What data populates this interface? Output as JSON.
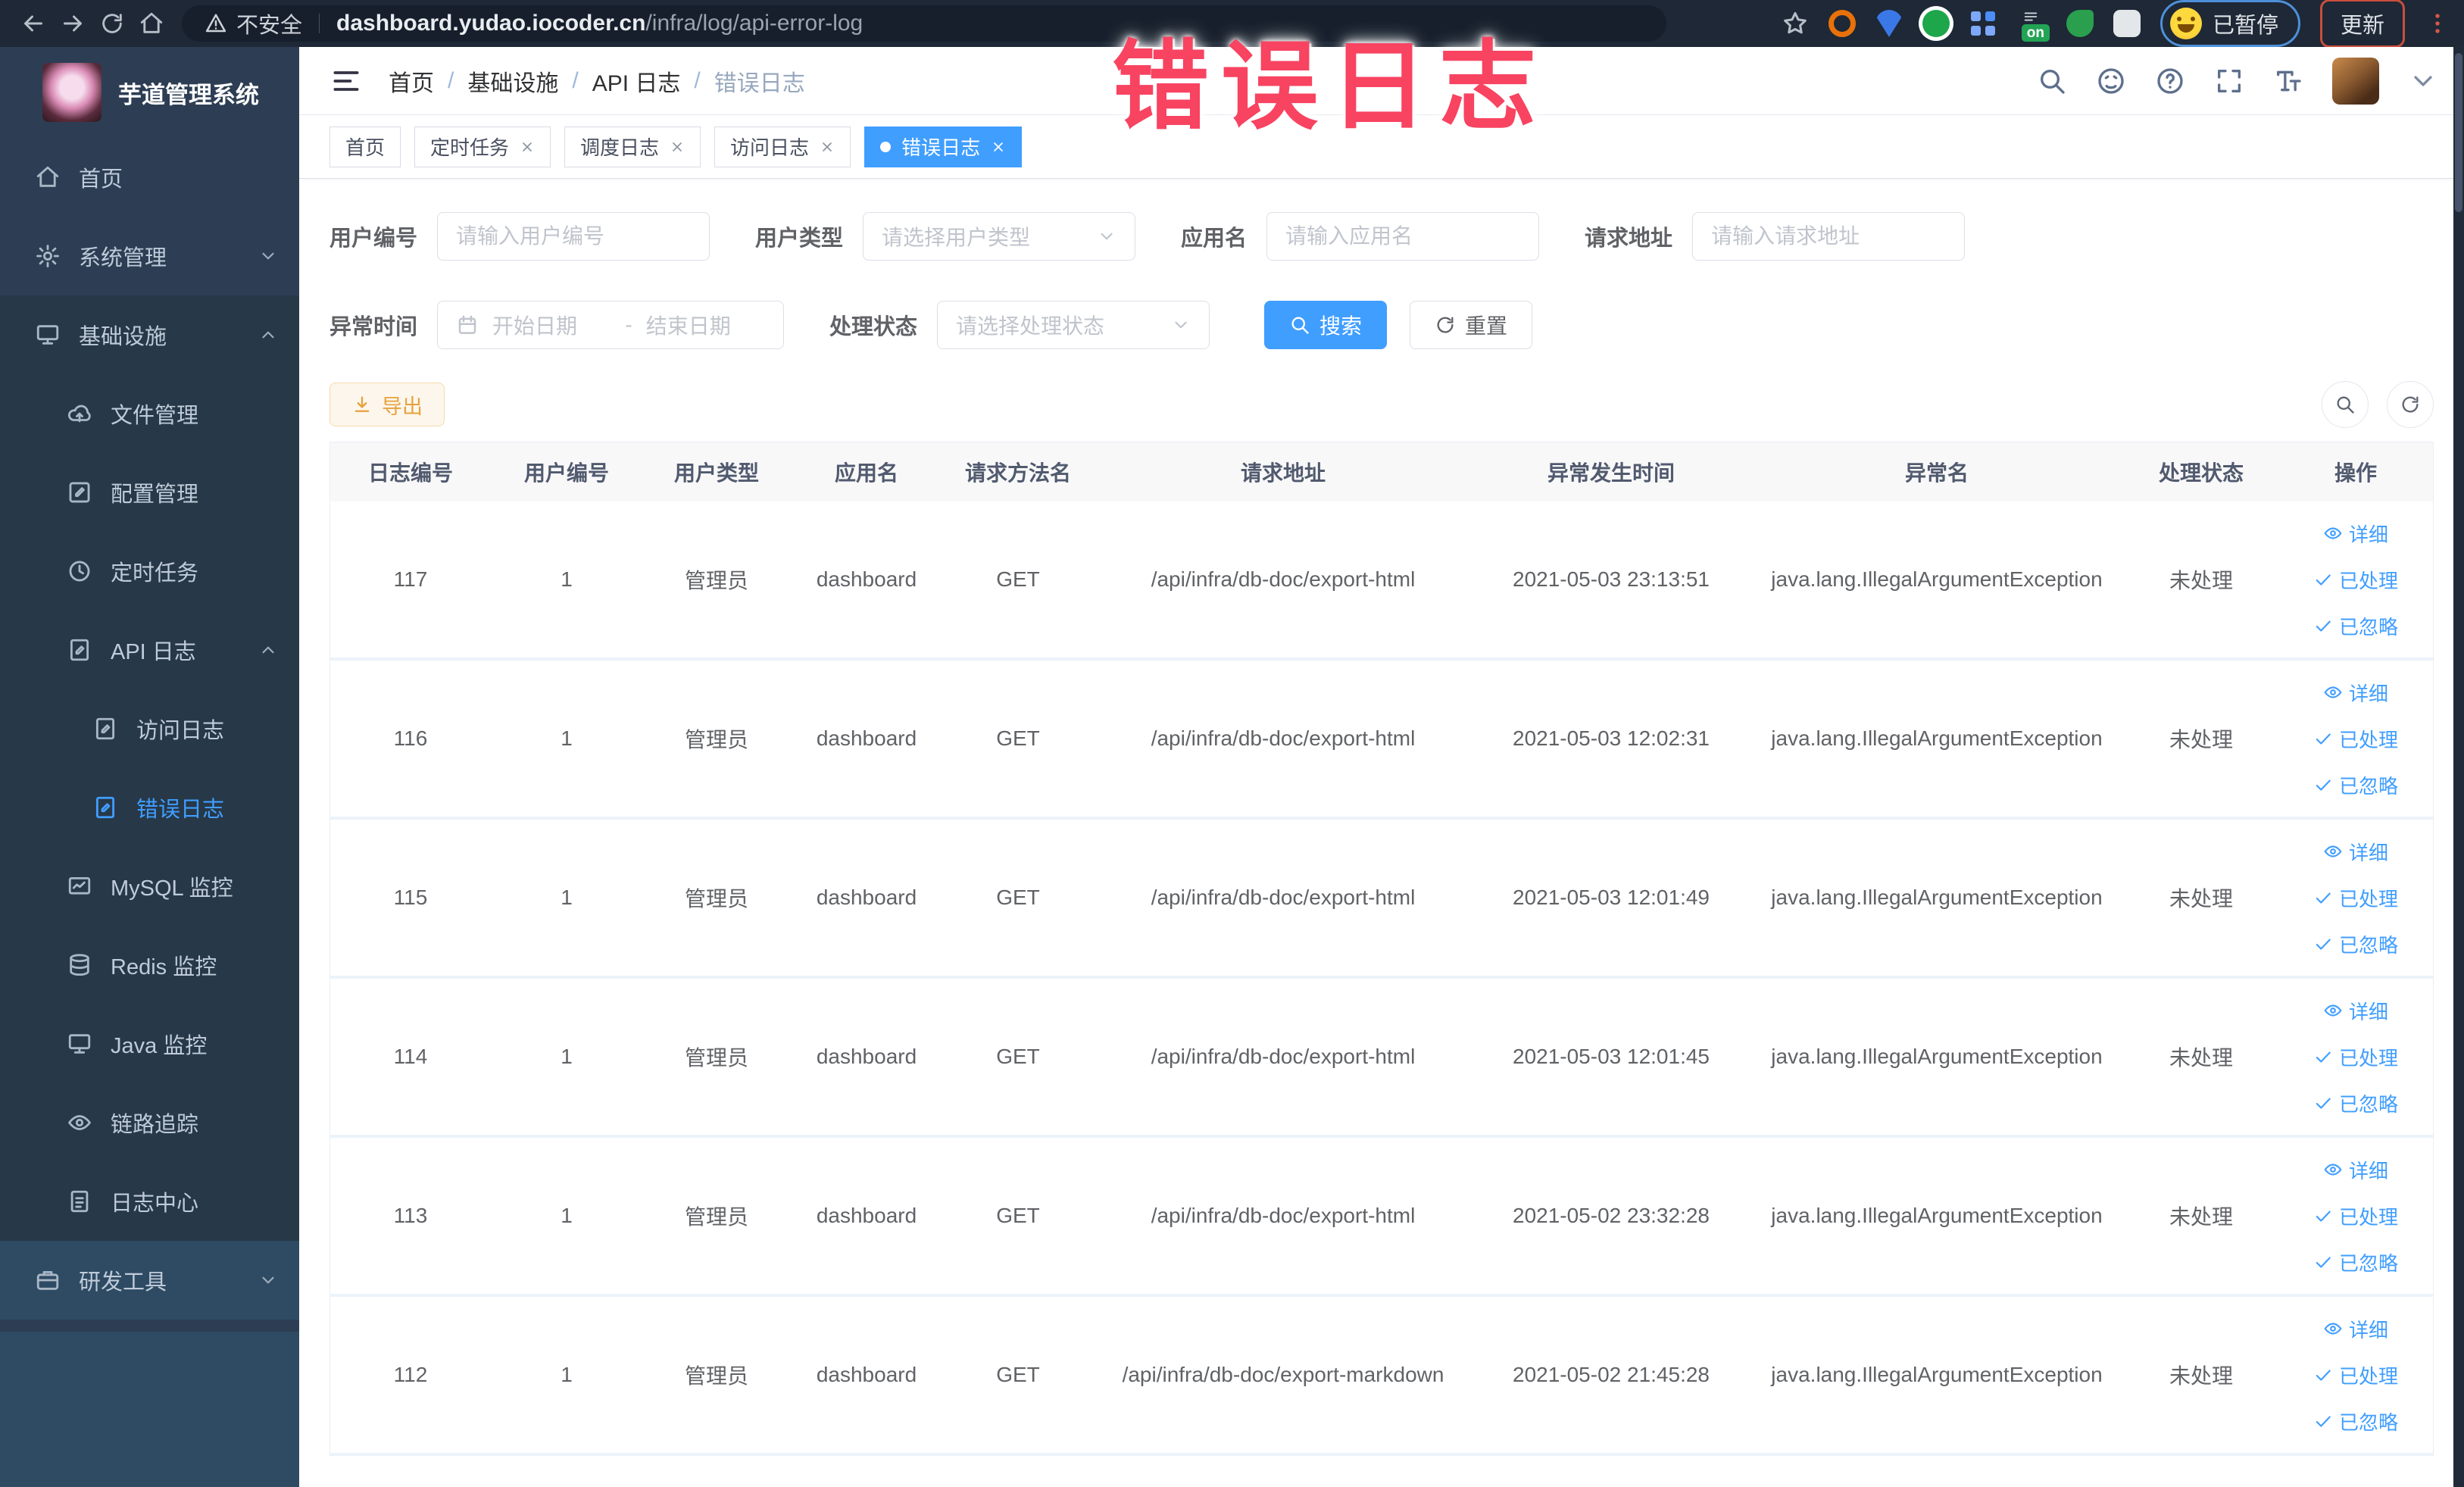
{
  "annotation": {
    "text": "错误日志"
  },
  "browser": {
    "security_label": "不安全",
    "url_host": "dashboard.yudao.iocoder.cn",
    "url_path": "/infra/log/api-error-log",
    "extension_on_badge": "on",
    "paused_label": "已暂停",
    "update_label": "更新"
  },
  "sidebar": {
    "logo_title": "芋道管理系统",
    "menu": [
      {
        "label": "首页"
      },
      {
        "label": "系统管理"
      },
      {
        "label": "基础设施"
      },
      {
        "label": "文件管理"
      },
      {
        "label": "配置管理"
      },
      {
        "label": "定时任务"
      },
      {
        "label": "API 日志"
      },
      {
        "label": "访问日志"
      },
      {
        "label": "错误日志"
      },
      {
        "label": "MySQL 监控"
      },
      {
        "label": "Redis 监控"
      },
      {
        "label": "Java 监控"
      },
      {
        "label": "链路追踪"
      },
      {
        "label": "日志中心"
      },
      {
        "label": "研发工具"
      }
    ]
  },
  "navbar": {
    "breadcrumb": [
      "首页",
      "基础设施",
      "API 日志",
      "错误日志"
    ],
    "separator": "/"
  },
  "tabs": [
    {
      "label": "首页",
      "closable": false,
      "active": false
    },
    {
      "label": "定时任务",
      "closable": true,
      "active": false
    },
    {
      "label": "调度日志",
      "closable": true,
      "active": false
    },
    {
      "label": "访问日志",
      "closable": true,
      "active": false
    },
    {
      "label": "错误日志",
      "closable": true,
      "active": true
    }
  ],
  "filters": {
    "user_id_label": "用户编号",
    "user_id_placeholder": "请输入用户编号",
    "user_type_label": "用户类型",
    "user_type_placeholder": "请选择用户类型",
    "app_name_label": "应用名",
    "app_name_placeholder": "请输入应用名",
    "request_url_label": "请求地址",
    "request_url_placeholder": "请输入请求地址",
    "exception_time_label": "异常时间",
    "date_start_placeholder": "开始日期",
    "date_separator": "-",
    "date_end_placeholder": "结束日期",
    "process_status_label": "处理状态",
    "process_status_placeholder": "请选择处理状态",
    "search_label": "搜索",
    "reset_label": "重置"
  },
  "toolbar": {
    "export_label": "导出"
  },
  "table": {
    "columns": [
      "日志编号",
      "用户编号",
      "用户类型",
      "应用名",
      "请求方法名",
      "请求地址",
      "异常发生时间",
      "异常名",
      "处理状态",
      "操作"
    ],
    "rows": [
      {
        "id": "117",
        "user_id": "1",
        "user_type": "管理员",
        "app": "dashboard",
        "method": "GET",
        "url": "/api/infra/db-doc/export-html",
        "time": "2021-05-03 23:13:51",
        "exception": "java.lang.IllegalArgumentException",
        "status": "未处理"
      },
      {
        "id": "116",
        "user_id": "1",
        "user_type": "管理员",
        "app": "dashboard",
        "method": "GET",
        "url": "/api/infra/db-doc/export-html",
        "time": "2021-05-03 12:02:31",
        "exception": "java.lang.IllegalArgumentException",
        "status": "未处理"
      },
      {
        "id": "115",
        "user_id": "1",
        "user_type": "管理员",
        "app": "dashboard",
        "method": "GET",
        "url": "/api/infra/db-doc/export-html",
        "time": "2021-05-03 12:01:49",
        "exception": "java.lang.IllegalArgumentException",
        "status": "未处理"
      },
      {
        "id": "114",
        "user_id": "1",
        "user_type": "管理员",
        "app": "dashboard",
        "method": "GET",
        "url": "/api/infra/db-doc/export-html",
        "time": "2021-05-03 12:01:45",
        "exception": "java.lang.IllegalArgumentException",
        "status": "未处理"
      },
      {
        "id": "113",
        "user_id": "1",
        "user_type": "管理员",
        "app": "dashboard",
        "method": "GET",
        "url": "/api/infra/db-doc/export-html",
        "time": "2021-05-02 23:32:28",
        "exception": "java.lang.IllegalArgumentException",
        "status": "未处理"
      },
      {
        "id": "112",
        "user_id": "1",
        "user_type": "管理员",
        "app": "dashboard",
        "method": "GET",
        "url": "/api/infra/db-doc/export-markdown",
        "time": "2021-05-02 21:45:28",
        "exception": "java.lang.IllegalArgumentException",
        "status": "未处理"
      }
    ],
    "actions": {
      "detail": "详细",
      "processed": "已处理",
      "ignored": "已忽略"
    }
  },
  "colors": {
    "accent": "#409eff",
    "warning": "#e6a23c",
    "sidebar_bg": "#2d3e54",
    "annotation": "#f84361"
  }
}
